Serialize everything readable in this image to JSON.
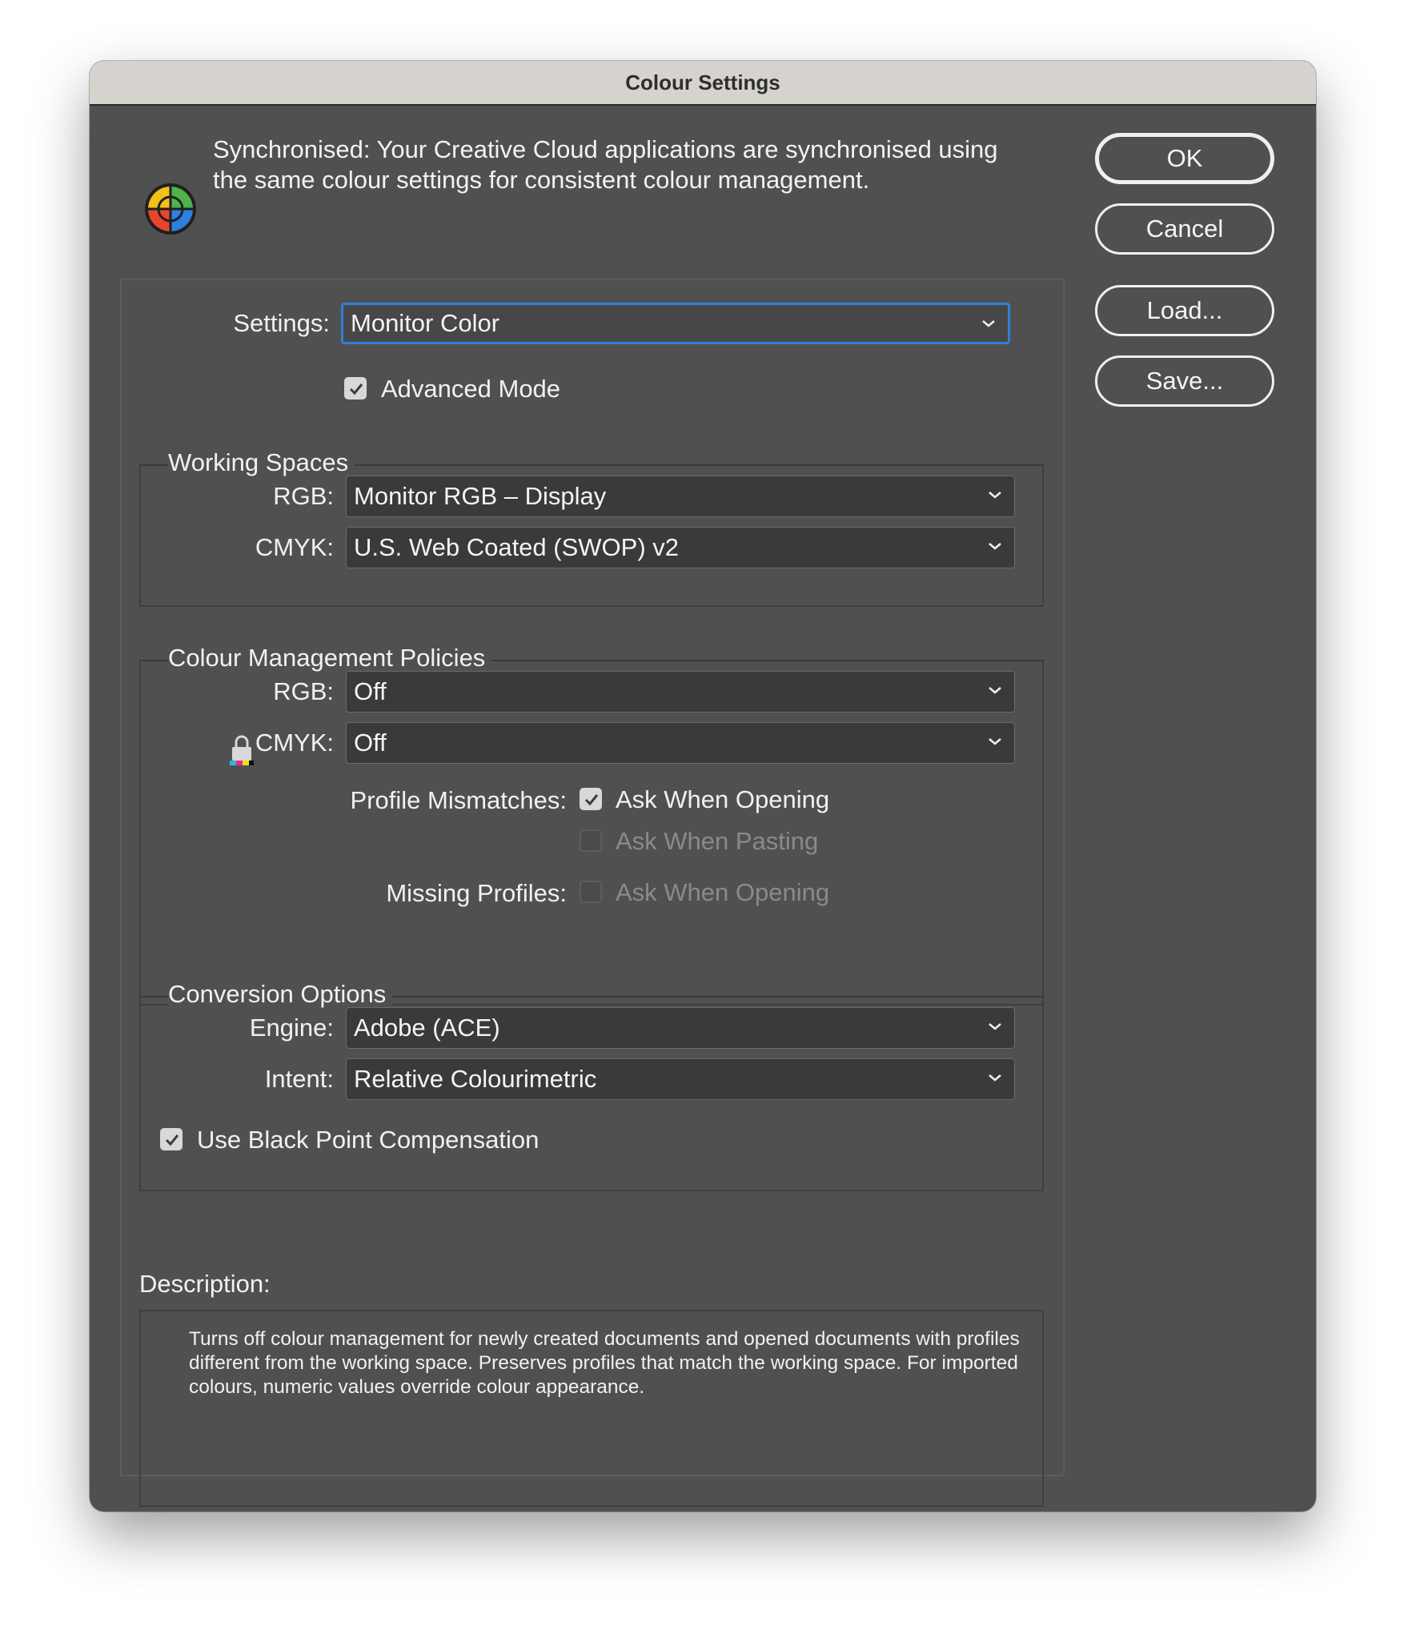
{
  "window": {
    "title": "Colour Settings"
  },
  "sync": {
    "icon": "color-sync-icon",
    "text": "Synchronised: Your Creative Cloud applications are synchronised using the same colour settings for consistent colour management."
  },
  "buttons": {
    "ok": "OK",
    "cancel": "Cancel",
    "load": "Load...",
    "save": "Save..."
  },
  "settings": {
    "label": "Settings:",
    "value": "Monitor Color",
    "advanced_mode_label": "Advanced Mode",
    "advanced_mode_checked": true
  },
  "working_spaces": {
    "title": "Working Spaces",
    "rgb_label": "RGB:",
    "rgb_value": "Monitor RGB – Display",
    "cmyk_label": "CMYK:",
    "cmyk_value": "U.S. Web Coated (SWOP) v2"
  },
  "policies": {
    "title": "Colour Management Policies",
    "rgb_label": "RGB:",
    "rgb_value": "Off",
    "cmyk_label": "CMYK:",
    "cmyk_value": "Off",
    "cmyk_icon": "lock-icon",
    "profile_mismatches_label": "Profile Mismatches:",
    "ask_when_opening_label": "Ask When Opening",
    "ask_when_opening_checked": true,
    "ask_when_pasting_label": "Ask When Pasting",
    "ask_when_pasting_checked": false,
    "missing_profiles_label": "Missing Profiles:",
    "missing_ask_when_opening_label": "Ask When Opening",
    "missing_ask_when_opening_checked": false
  },
  "conversion": {
    "title": "Conversion Options",
    "engine_label": "Engine:",
    "engine_value": "Adobe (ACE)",
    "intent_label": "Intent:",
    "intent_value": "Relative Colourimetric",
    "black_point_label": "Use Black Point Compensation",
    "black_point_checked": true
  },
  "description": {
    "label": "Description:",
    "text": "Turns off colour management for newly created documents and opened documents with profiles different from the working space. Preserves profiles that match the working space. For imported colours, numeric values override colour appearance."
  },
  "colors": {
    "window_bg": "#505050",
    "titlebar_bg": "#d6d3cf",
    "focus_ring": "#2f7fd6",
    "field_bg": "#3a3a3a"
  }
}
